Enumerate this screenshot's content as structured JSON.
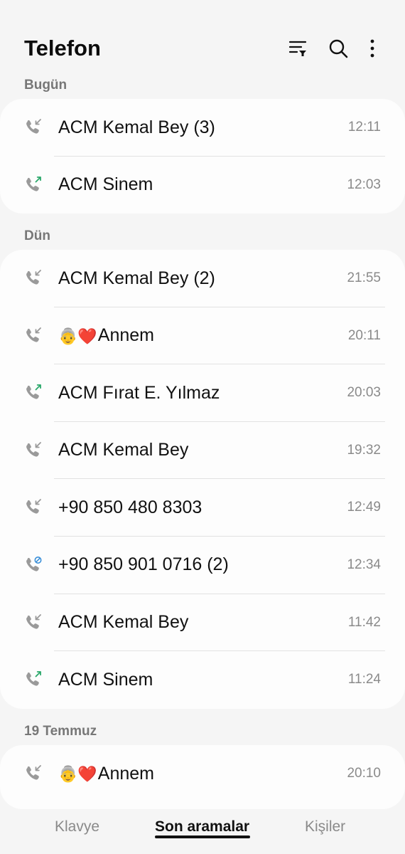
{
  "header": {
    "title": "Telefon",
    "filter_icon": "filter-icon",
    "search_icon": "search-icon",
    "more_icon": "more-vert-icon"
  },
  "colors": {
    "incoming": "#9a9a9a",
    "outgoing": "#2aa86a",
    "blocked": "#3a8fd8"
  },
  "sections": [
    {
      "label": "Bugün",
      "calls": [
        {
          "type": "incoming",
          "icon": "incoming-call-icon",
          "name": "ACM Kemal Bey (3)",
          "time": "12:11"
        },
        {
          "type": "outgoing",
          "icon": "outgoing-call-icon",
          "name": "ACM Sinem",
          "time": "12:03"
        }
      ]
    },
    {
      "label": "Dün",
      "calls": [
        {
          "type": "incoming",
          "icon": "incoming-call-icon",
          "name": "ACM Kemal Bey (2)",
          "time": "21:55"
        },
        {
          "type": "incoming",
          "icon": "incoming-call-icon",
          "emoji": "👵❤️",
          "name": "Annem",
          "time": "20:11"
        },
        {
          "type": "outgoing",
          "icon": "outgoing-call-icon",
          "name": "ACM Fırat E. Yılmaz",
          "time": "20:03"
        },
        {
          "type": "incoming",
          "icon": "incoming-call-icon",
          "name": "ACM Kemal Bey",
          "time": "19:32"
        },
        {
          "type": "incoming",
          "icon": "incoming-call-icon",
          "name": "+90 850 480 8303",
          "time": "12:49"
        },
        {
          "type": "blocked",
          "icon": "blocked-call-icon",
          "name": "+90 850 901 0716 (2)",
          "time": "12:34"
        },
        {
          "type": "incoming",
          "icon": "incoming-call-icon",
          "name": "ACM Kemal Bey",
          "time": "11:42"
        },
        {
          "type": "outgoing",
          "icon": "outgoing-call-icon",
          "name": "ACM Sinem",
          "time": "11:24"
        }
      ]
    },
    {
      "label": "19 Temmuz",
      "calls": [
        {
          "type": "incoming",
          "icon": "incoming-call-icon",
          "emoji": "👵❤️",
          "name": "Annem",
          "time": "20:10"
        }
      ]
    }
  ],
  "bottom_nav": {
    "tabs": [
      "Klavye",
      "Son aramalar",
      "Kişiler"
    ],
    "active_index": 1
  }
}
